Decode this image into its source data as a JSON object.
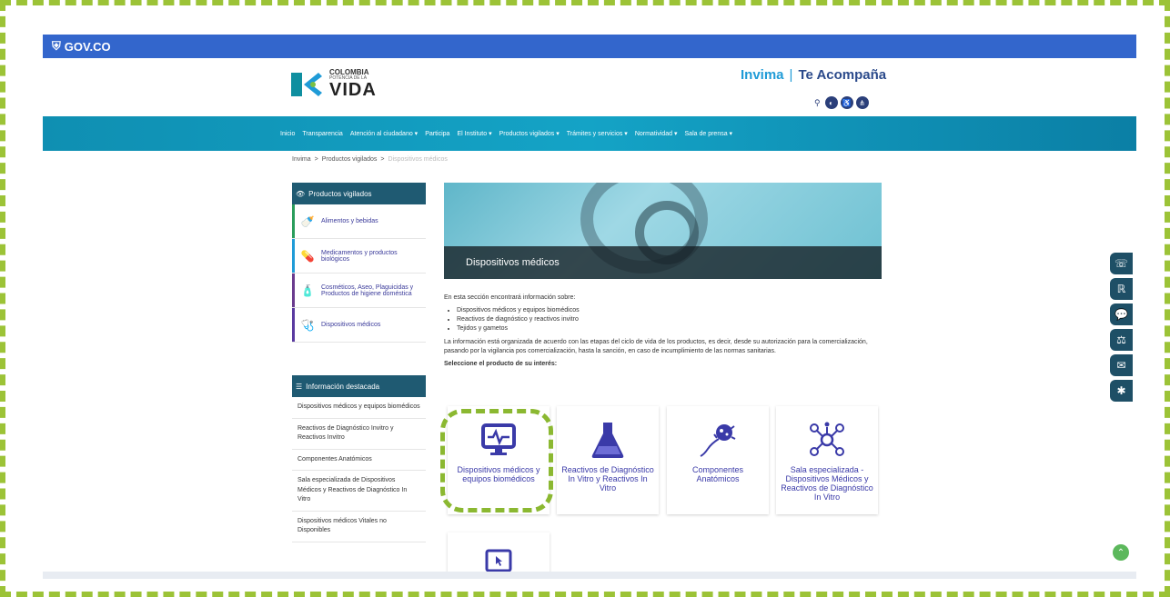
{
  "govbar": {
    "label": "GOV.CO"
  },
  "logo_colombia": {
    "line1": "COLOMBIA",
    "line2": "POTENCIA DE LA",
    "line3": "VIDA"
  },
  "logo_invima": {
    "brand": "Invima",
    "tagline": "Te Acompaña"
  },
  "nav": [
    "Inicio",
    "Transparencia",
    "Atención al ciudadano ▾",
    "Participa",
    "El Instituto ▾",
    "Productos vigilados ▾",
    "Trámites y servicios ▾",
    "Normatividad ▾",
    "Sala de prensa ▾"
  ],
  "breadcrumb": [
    "Invima",
    ">",
    "Productos vigilados",
    ">",
    "Dispositivos médicos"
  ],
  "sidebar": {
    "title": "Productos vigilados",
    "items": [
      {
        "label": "Alimentos y bebidas",
        "color": "#2a9d5c",
        "icon": "🍼"
      },
      {
        "label": "Medicamentos y productos biológicos",
        "color": "#1f9bd7",
        "icon": "💊"
      },
      {
        "label": "Cosméticos, Aseo, Plaguicidas y Productos de higiene doméstica",
        "color": "#6a3b8e",
        "icon": "🧴"
      },
      {
        "label": "Dispositivos médicos",
        "color": "#5a3aa0",
        "icon": "🩺"
      }
    ]
  },
  "info": {
    "title": "Información destacada",
    "items": [
      "Dispositivos médicos y equipos biomédicos",
      "Reactivos de Diagnóstico Invitro y Reactivos Invitro",
      "Componentes Anatómicos",
      "Sala especializada de Dispositivos Médicos y Reactivos de Diagnóstico In Vitro",
      "Dispositivos médicos Vitales no Disponibles"
    ]
  },
  "hero": {
    "caption": "Dispositivos médicos"
  },
  "content": {
    "intro": "En esta sección encontrará información sobre:",
    "bullets": [
      "Dispositivos médicos y equipos biomédicos",
      "Reactivos de diagnóstico y reactivos invitro",
      "Tejidos y gametos"
    ],
    "paragraph": "La información está organizada de acuerdo con las etapas del ciclo de vida de los productos, es decir, desde su autorización para la comercialización, pasando por la vigilancia pos comercialización, hasta la sanción, en caso de incumplimiento de las normas sanitarias.",
    "select_label": "Seleccione el producto de su interés:"
  },
  "cards": [
    {
      "label": "Dispositivos médicos y equipos biomédicos",
      "icon": "monitor-icon"
    },
    {
      "label": "Reactivos de Diagnóstico In Vitro y Reactivos In Vitro",
      "icon": "flask-icon"
    },
    {
      "label": "Componentes Anatómicos",
      "icon": "cell-icon"
    },
    {
      "label": "Sala especializada - Dispositivos Médicos y Reactivos de Diagnóstico In Vitro",
      "icon": "network-icon"
    }
  ],
  "floatbar": [
    "☏",
    "ℝ",
    "💬",
    "⚖",
    "✉",
    "✱"
  ],
  "colors": {
    "govbar": "#3366cc",
    "nav": "#14a3c6",
    "accent": "#8bb831"
  }
}
